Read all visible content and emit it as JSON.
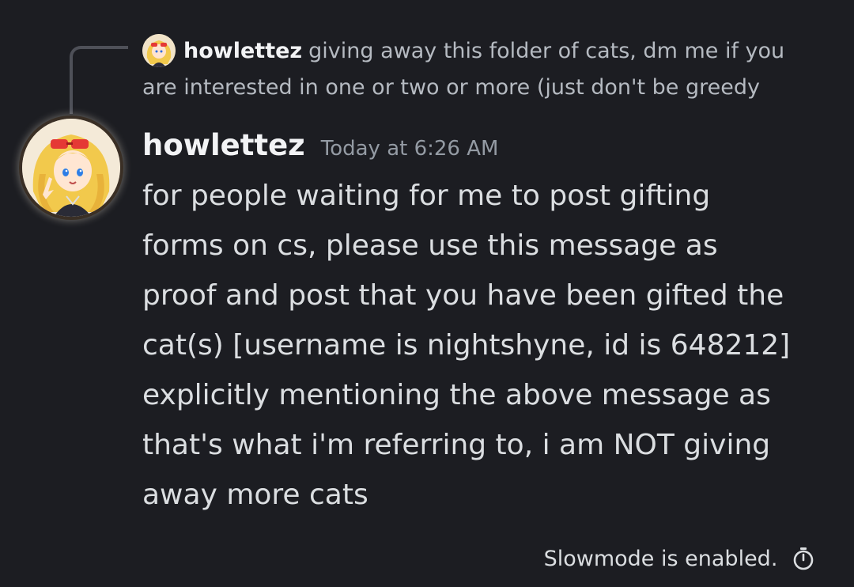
{
  "reply": {
    "author": "howlettez",
    "text": "giving away this folder of cats, dm me if you are interested in one or two or more (just don't be greedy"
  },
  "message": {
    "author": "howlettez",
    "timestamp": "Today at 6:26 AM",
    "lines": [
      "for people waiting for me to post gifting",
      "forms on cs, please use this message as",
      "proof and post that you have been gifted the",
      "cat(s) [username is nightshyne, id is 648212]",
      "explicitly mentioning the above message as",
      "that's what i'm referring to, i am NOT giving",
      "away more cats"
    ]
  },
  "footer": {
    "slowmode_text": "Slowmode is enabled."
  },
  "colors": {
    "background": "#1c1d22",
    "author": "#f2f3f5",
    "body_text": "#dbdee1",
    "muted_text": "#949ba4",
    "reply_spine": "#4e5058"
  },
  "icons": {
    "avatar": "user-avatar-anime-girl-icon",
    "slowmode": "stopwatch-icon"
  }
}
